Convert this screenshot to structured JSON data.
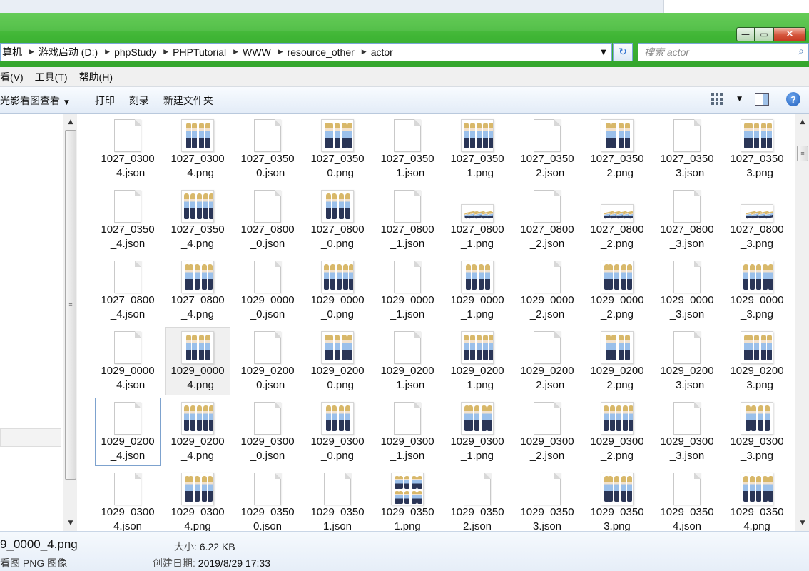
{
  "window": {
    "caption_buttons": {
      "minimize": "—",
      "maximize": "▭",
      "close": "✕"
    }
  },
  "address": {
    "crumbs": [
      "算机",
      "游戏启动 (D:)",
      "phpStudy",
      "PHPTutorial",
      "WWW",
      "resource_other",
      "actor"
    ],
    "dropdown_icon": "chevron-down",
    "refresh_icon": "refresh"
  },
  "search": {
    "placeholder": "搜索 actor"
  },
  "menubar": {
    "items": [
      "看(V)",
      "工具(T)",
      "帮助(H)"
    ]
  },
  "toolbar": {
    "items": [
      "光影看图查看",
      "打印",
      "刻录",
      "新建文件夹"
    ],
    "view_icon": "grid-view",
    "preview_icon": "preview-pane",
    "help_icon": "help"
  },
  "files": [
    {
      "line1": "1027_0300",
      "line2": "_4.json",
      "type": "json"
    },
    {
      "line1": "1027_0300",
      "line2": "_4.png",
      "type": "png"
    },
    {
      "line1": "1027_0350",
      "line2": "_0.json",
      "type": "json"
    },
    {
      "line1": "1027_0350",
      "line2": "_0.png",
      "type": "png"
    },
    {
      "line1": "1027_0350",
      "line2": "_1.json",
      "type": "json"
    },
    {
      "line1": "1027_0350",
      "line2": "_1.png",
      "type": "png"
    },
    {
      "line1": "1027_0350",
      "line2": "_2.json",
      "type": "json"
    },
    {
      "line1": "1027_0350",
      "line2": "_2.png",
      "type": "png"
    },
    {
      "line1": "1027_0350",
      "line2": "_3.json",
      "type": "json"
    },
    {
      "line1": "1027_0350",
      "line2": "_3.png",
      "type": "png"
    },
    {
      "line1": "1027_0350",
      "line2": "_4.json",
      "type": "json"
    },
    {
      "line1": "1027_0350",
      "line2": "_4.png",
      "type": "png"
    },
    {
      "line1": "1027_0800",
      "line2": "_0.json",
      "type": "json"
    },
    {
      "line1": "1027_0800",
      "line2": "_0.png",
      "type": "png"
    },
    {
      "line1": "1027_0800",
      "line2": "_1.json",
      "type": "json"
    },
    {
      "line1": "1027_0800",
      "line2": "_1.png",
      "type": "png-wide"
    },
    {
      "line1": "1027_0800",
      "line2": "_2.json",
      "type": "json"
    },
    {
      "line1": "1027_0800",
      "line2": "_2.png",
      "type": "png-wide"
    },
    {
      "line1": "1027_0800",
      "line2": "_3.json",
      "type": "json"
    },
    {
      "line1": "1027_0800",
      "line2": "_3.png",
      "type": "png-wide"
    },
    {
      "line1": "1027_0800",
      "line2": "_4.json",
      "type": "json"
    },
    {
      "line1": "1027_0800",
      "line2": "_4.png",
      "type": "png"
    },
    {
      "line1": "1029_0000",
      "line2": "_0.json",
      "type": "json"
    },
    {
      "line1": "1029_0000",
      "line2": "_0.png",
      "type": "png"
    },
    {
      "line1": "1029_0000",
      "line2": "_1.json",
      "type": "json"
    },
    {
      "line1": "1029_0000",
      "line2": "_1.png",
      "type": "png"
    },
    {
      "line1": "1029_0000",
      "line2": "_2.json",
      "type": "json"
    },
    {
      "line1": "1029_0000",
      "line2": "_2.png",
      "type": "png"
    },
    {
      "line1": "1029_0000",
      "line2": "_3.json",
      "type": "json"
    },
    {
      "line1": "1029_0000",
      "line2": "_3.png",
      "type": "png"
    },
    {
      "line1": "1029_0000",
      "line2": "_4.json",
      "type": "json"
    },
    {
      "line1": "1029_0000",
      "line2": "_4.png",
      "type": "png",
      "state": "hot"
    },
    {
      "line1": "1029_0200",
      "line2": "_0.json",
      "type": "json"
    },
    {
      "line1": "1029_0200",
      "line2": "_0.png",
      "type": "png"
    },
    {
      "line1": "1029_0200",
      "line2": "_1.json",
      "type": "json"
    },
    {
      "line1": "1029_0200",
      "line2": "_1.png",
      "type": "png"
    },
    {
      "line1": "1029_0200",
      "line2": "_2.json",
      "type": "json"
    },
    {
      "line1": "1029_0200",
      "line2": "_2.png",
      "type": "png"
    },
    {
      "line1": "1029_0200",
      "line2": "_3.json",
      "type": "json"
    },
    {
      "line1": "1029_0200",
      "line2": "_3.png",
      "type": "png"
    },
    {
      "line1": "1029_0200",
      "line2": "_4.json",
      "type": "json",
      "state": "focus"
    },
    {
      "line1": "1029_0200",
      "line2": "_4.png",
      "type": "png"
    },
    {
      "line1": "1029_0300",
      "line2": "_0.json",
      "type": "json"
    },
    {
      "line1": "1029_0300",
      "line2": "_0.png",
      "type": "png"
    },
    {
      "line1": "1029_0300",
      "line2": "_1.json",
      "type": "json"
    },
    {
      "line1": "1029_0300",
      "line2": "_1.png",
      "type": "png"
    },
    {
      "line1": "1029_0300",
      "line2": "_2.json",
      "type": "json"
    },
    {
      "line1": "1029_0300",
      "line2": "_2.png",
      "type": "png"
    },
    {
      "line1": "1029_0300",
      "line2": "_3.json",
      "type": "json"
    },
    {
      "line1": "1029_0300",
      "line2": "_3.png",
      "type": "png"
    },
    {
      "line1": "1029_0300",
      "line2": "4.json",
      "type": "json"
    },
    {
      "line1": "1029_0300",
      "line2": "4.png",
      "type": "png"
    },
    {
      "line1": "1029_0350",
      "line2": "0.json",
      "type": "json"
    },
    {
      "line1": "1029_0350",
      "line2": "1.json",
      "type": "json"
    },
    {
      "line1": "1029_0350",
      "line2": "1.png",
      "type": "png"
    },
    {
      "line1": "1029_0350",
      "line2": "2.json",
      "type": "json"
    },
    {
      "line1": "1029_0350",
      "line2": "3.json",
      "type": "json"
    },
    {
      "line1": "1029_0350",
      "line2": "3.png",
      "type": "png"
    },
    {
      "line1": "1029_0350",
      "line2": "4.json",
      "type": "json"
    },
    {
      "line1": "1029_0350",
      "line2": "4.png",
      "type": "png"
    }
  ],
  "details": {
    "filename": "9_0000_4.png",
    "filetype": "看图 PNG 图像",
    "size_label": "大小:",
    "size_value": "6.22 KB",
    "date_label": "创建日期:",
    "date_value": "2019/8/29 17:33"
  },
  "colors": {
    "frame_green": "#3fb535",
    "address_border": "#7aa7d8",
    "selection_border": "#7da2ce",
    "hot_bg": "#f0f0f0"
  }
}
